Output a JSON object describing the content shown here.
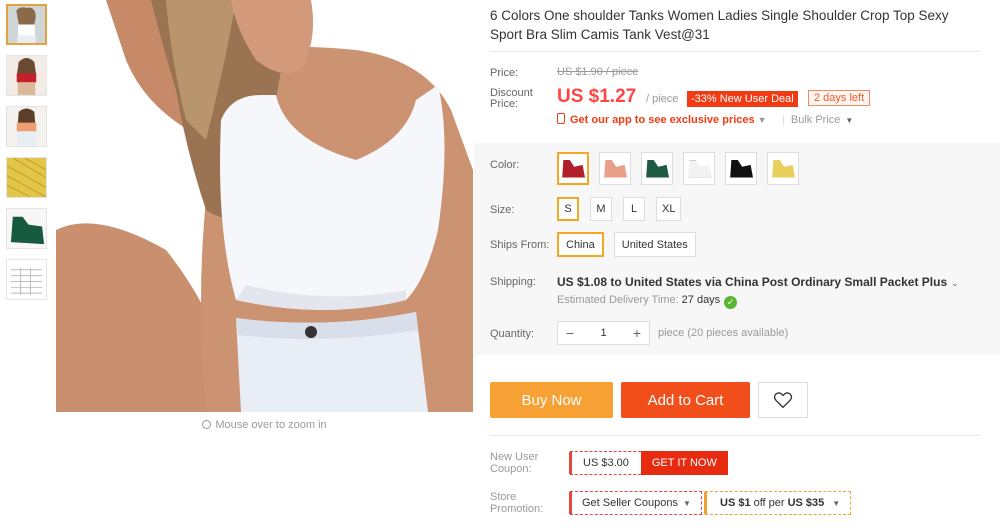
{
  "product": {
    "title": "6 Colors One shoulder Tanks Women Ladies Single Shoulder Crop Top Sexy Sport Bra Slim Camis Tank Vest@31",
    "zoom_hint": "Mouse over to zoom in"
  },
  "thumbnails": [
    {
      "name": "model-white-front",
      "active": true
    },
    {
      "name": "model-side",
      "active": false
    },
    {
      "name": "model-orange",
      "active": false
    },
    {
      "name": "yellow-fabric",
      "active": false
    },
    {
      "name": "green-top",
      "active": false
    },
    {
      "name": "size-chart",
      "active": false
    }
  ],
  "price": {
    "label": "Price:",
    "original": "US $1.90 / piece",
    "discount_label_1": "Discount",
    "discount_label_2": "Price:",
    "current": "US $1.27",
    "per": "/ piece",
    "deal": "-33% New User Deal",
    "days_left": "2 days left",
    "app_text": "Get our app to see exclusive prices",
    "bulk": "Bulk Price"
  },
  "color": {
    "label": "Color:",
    "swatches": [
      {
        "name": "red",
        "hex": "#b01f2a",
        "selected": true
      },
      {
        "name": "pink",
        "hex": "#e8a089",
        "selected": false
      },
      {
        "name": "green",
        "hex": "#1d5b44",
        "selected": false
      },
      {
        "name": "white",
        "hex": "#f2f2f2",
        "selected": false
      },
      {
        "name": "black",
        "hex": "#111111",
        "selected": false
      },
      {
        "name": "yellow",
        "hex": "#e9cf5e",
        "selected": false
      }
    ]
  },
  "size": {
    "label": "Size:",
    "options": [
      "S",
      "M",
      "L",
      "XL"
    ],
    "selected": "S"
  },
  "ships_from": {
    "label": "Ships From:",
    "options": [
      "China",
      "United States"
    ],
    "selected": "China"
  },
  "shipping": {
    "label": "Shipping:",
    "text": "US $1.08 to United States via China Post Ordinary Small Packet Plus",
    "eta_label": "Estimated Delivery Time:",
    "eta_days": "27 days"
  },
  "quantity": {
    "label": "Quantity:",
    "value": "1",
    "minus": "−",
    "plus": "+",
    "note": "piece (20 pieces available)"
  },
  "actions": {
    "buy_now": "Buy Now",
    "add_to_cart": "Add to Cart"
  },
  "coupon": {
    "label_1": "New User",
    "label_2": "Coupon:",
    "amount": "US $3.00",
    "get": "GET IT NOW"
  },
  "promotion": {
    "label_1": "Store",
    "label_2": "Promotion:",
    "seller_coupons": "Get Seller Coupons",
    "offer_pre": "US $1",
    "offer_mid": "off per",
    "offer_post": "US $35"
  },
  "colors": {
    "accent": "#f14e1c",
    "buy": "#f7a033",
    "price": "#ff4444",
    "selected_border": "#f5a623"
  }
}
